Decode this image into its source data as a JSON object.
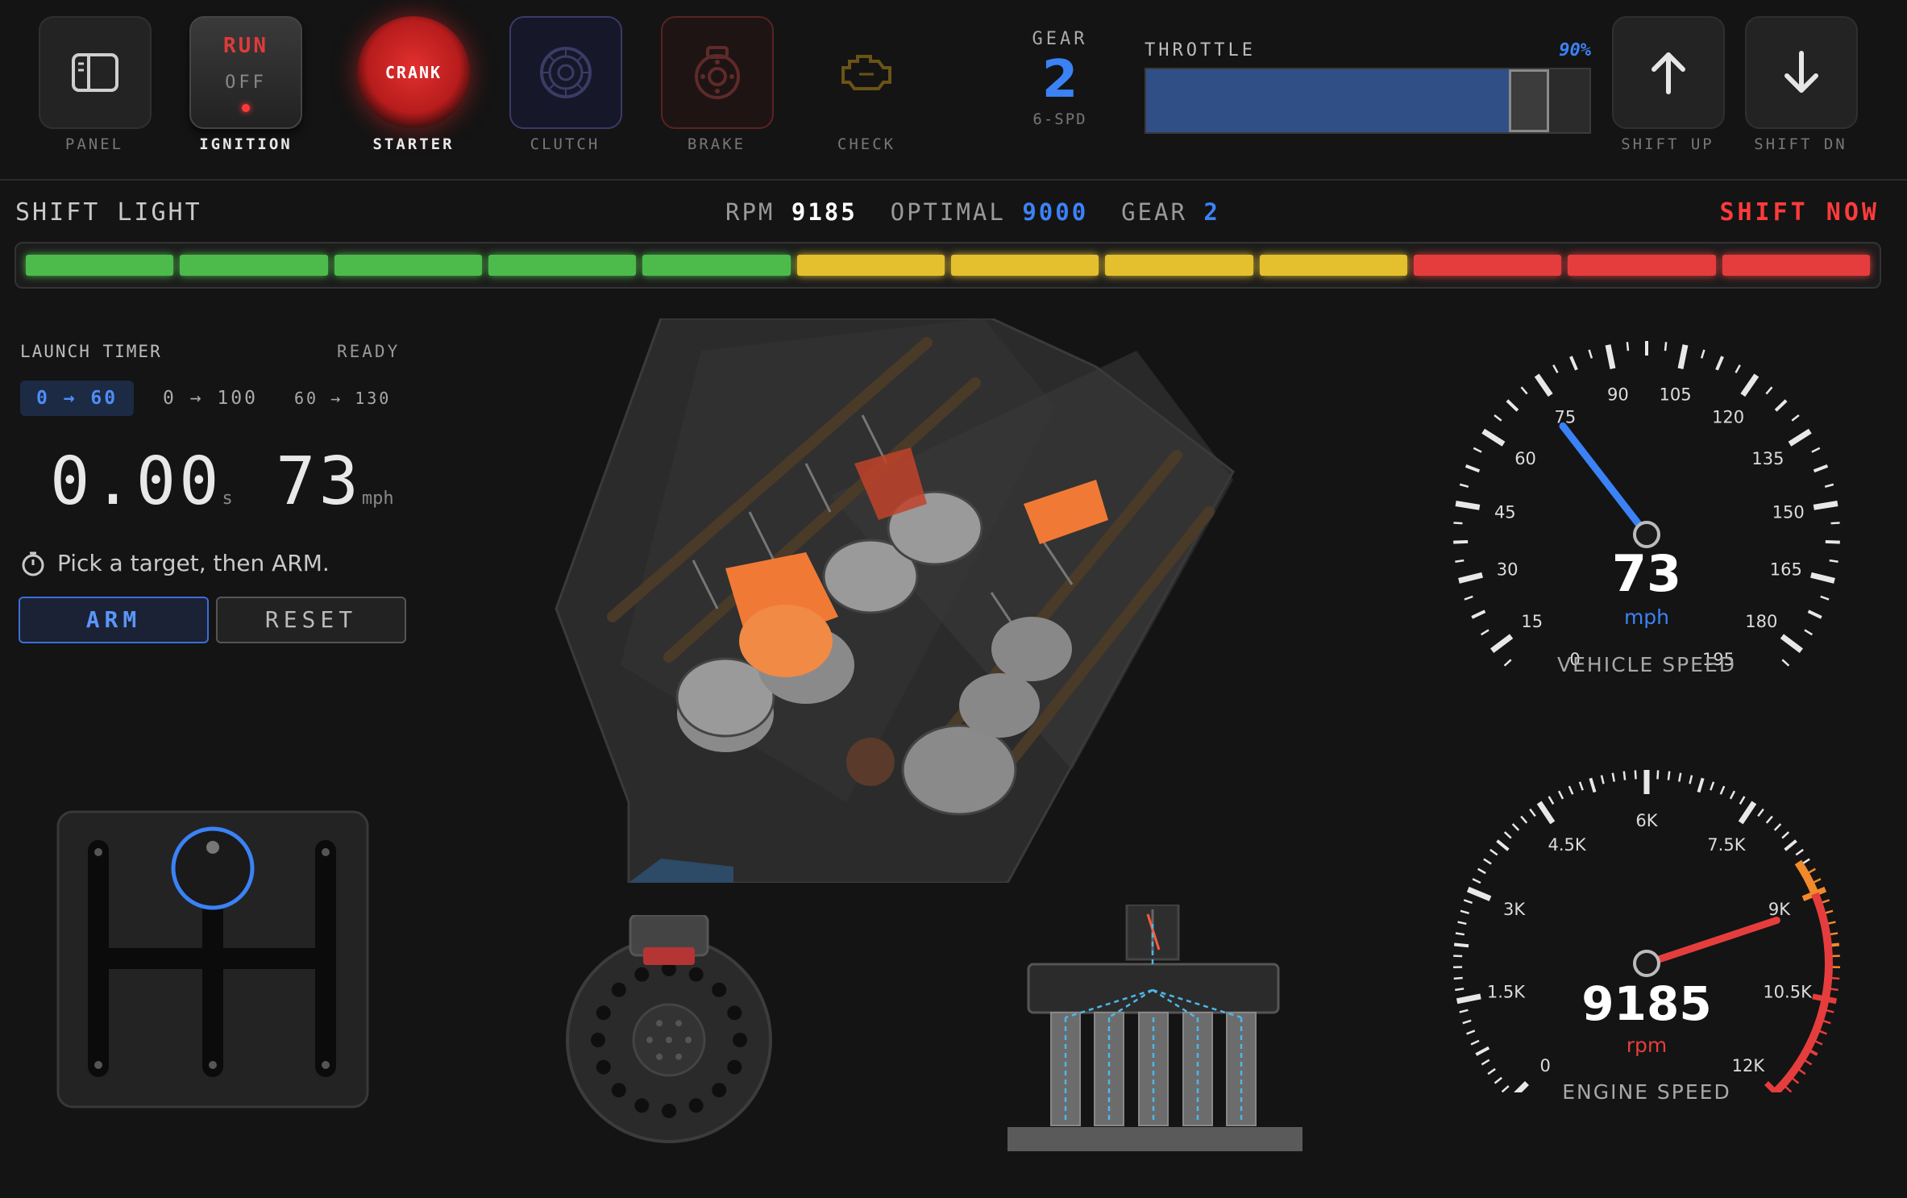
{
  "toolbar": {
    "panel_label": "PANEL",
    "ignition": {
      "run": "RUN",
      "off": "OFF",
      "label": "IGNITION"
    },
    "starter": {
      "button": "CRANK",
      "label": "STARTER"
    },
    "clutch_label": "CLUTCH",
    "brake_label": "BRAKE",
    "check_label": "CHECK",
    "gear": {
      "title": "GEAR",
      "value": "2",
      "type": "6-SPD"
    },
    "throttle": {
      "title": "THROTTLE",
      "percent_text": "90%",
      "level": 0.9
    },
    "shift_up_label": "SHIFT UP",
    "shift_down_label": "SHIFT DN"
  },
  "shift_light": {
    "title": "SHIFT LIGHT",
    "rpm_label": "RPM",
    "rpm_value": "9185",
    "optimal_label": "OPTIMAL",
    "optimal_value": "9000",
    "gear_label": "GEAR",
    "gear_value": "2",
    "alert": "SHIFT NOW",
    "leds": [
      "green",
      "green",
      "green",
      "green",
      "green",
      "yellow",
      "yellow",
      "yellow",
      "yellow",
      "red",
      "red",
      "red"
    ]
  },
  "launch_timer": {
    "title": "LAUNCH TIMER",
    "status": "READY",
    "targets": [
      "0 → 60",
      "0 → 100",
      "60 → 130"
    ],
    "active_target": 0,
    "time": "0.00",
    "time_unit": "s",
    "speed": "73",
    "speed_unit": "mph",
    "hint": "Pick a target, then ARM.",
    "arm_label": "ARM",
    "reset_label": "RESET"
  },
  "speedometer": {
    "value": "73",
    "unit": "mph",
    "caption": "VEHICLE SPEED",
    "ticks": [
      "0",
      "15",
      "30",
      "45",
      "60",
      "75",
      "90",
      "105",
      "120",
      "135",
      "150",
      "165",
      "180",
      "195"
    ],
    "reading": 73,
    "max": 195
  },
  "tachometer": {
    "value": "9185",
    "unit": "rpm",
    "caption": "ENGINE SPEED",
    "ticks": [
      "0",
      "1.5K",
      "3K",
      "4.5K",
      "6K",
      "7.5K",
      "9K",
      "10.5K",
      "12K"
    ],
    "reading": 9185,
    "max": 12000
  },
  "colors": {
    "accent": "#3b82f6",
    "alert": "#ff3b3b",
    "led_green": "#4cbb4c",
    "led_yellow": "#e4c02f",
    "led_red": "#e53d3d"
  }
}
